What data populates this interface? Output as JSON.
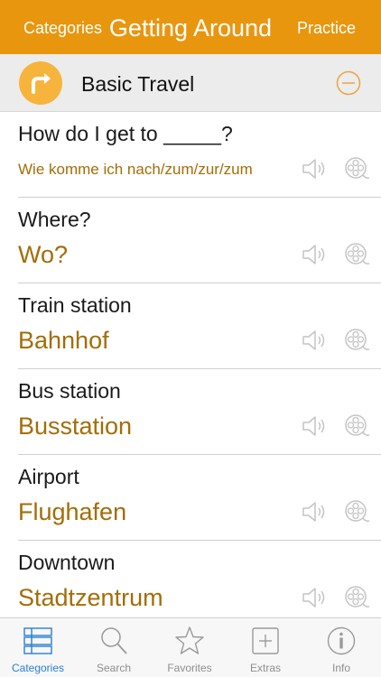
{
  "navbar": {
    "left_label": "Categories",
    "title": "Getting Around",
    "right_label": "Practice"
  },
  "section": {
    "title": "Basic Travel",
    "icon": "turn-right-arrow-icon"
  },
  "rows": [
    {
      "phrase": "How do I get to _____?",
      "translation": "Wie komme ich nach/zum/zur/zum"
    },
    {
      "phrase": "Where?",
      "translation": "Wo?"
    },
    {
      "phrase": "Train station",
      "translation": "Bahnhof"
    },
    {
      "phrase": "Bus station",
      "translation": "Busstation"
    },
    {
      "phrase": "Airport",
      "translation": "Flughafen"
    },
    {
      "phrase": "Downtown",
      "translation": "Stadtzentrum"
    }
  ],
  "tabs": [
    {
      "label": "Categories",
      "icon": "list-icon",
      "active": true
    },
    {
      "label": "Search",
      "icon": "search-icon",
      "active": false
    },
    {
      "label": "Favorites",
      "icon": "star-icon",
      "active": false
    },
    {
      "label": "Extras",
      "icon": "plus-box-icon",
      "active": false
    },
    {
      "label": "Info",
      "icon": "info-icon",
      "active": false
    }
  ],
  "colors": {
    "navbar": "#e9960f",
    "translation": "#a36d06",
    "active_tab": "#2a7fd0",
    "section_icon": "#f7b43c"
  }
}
